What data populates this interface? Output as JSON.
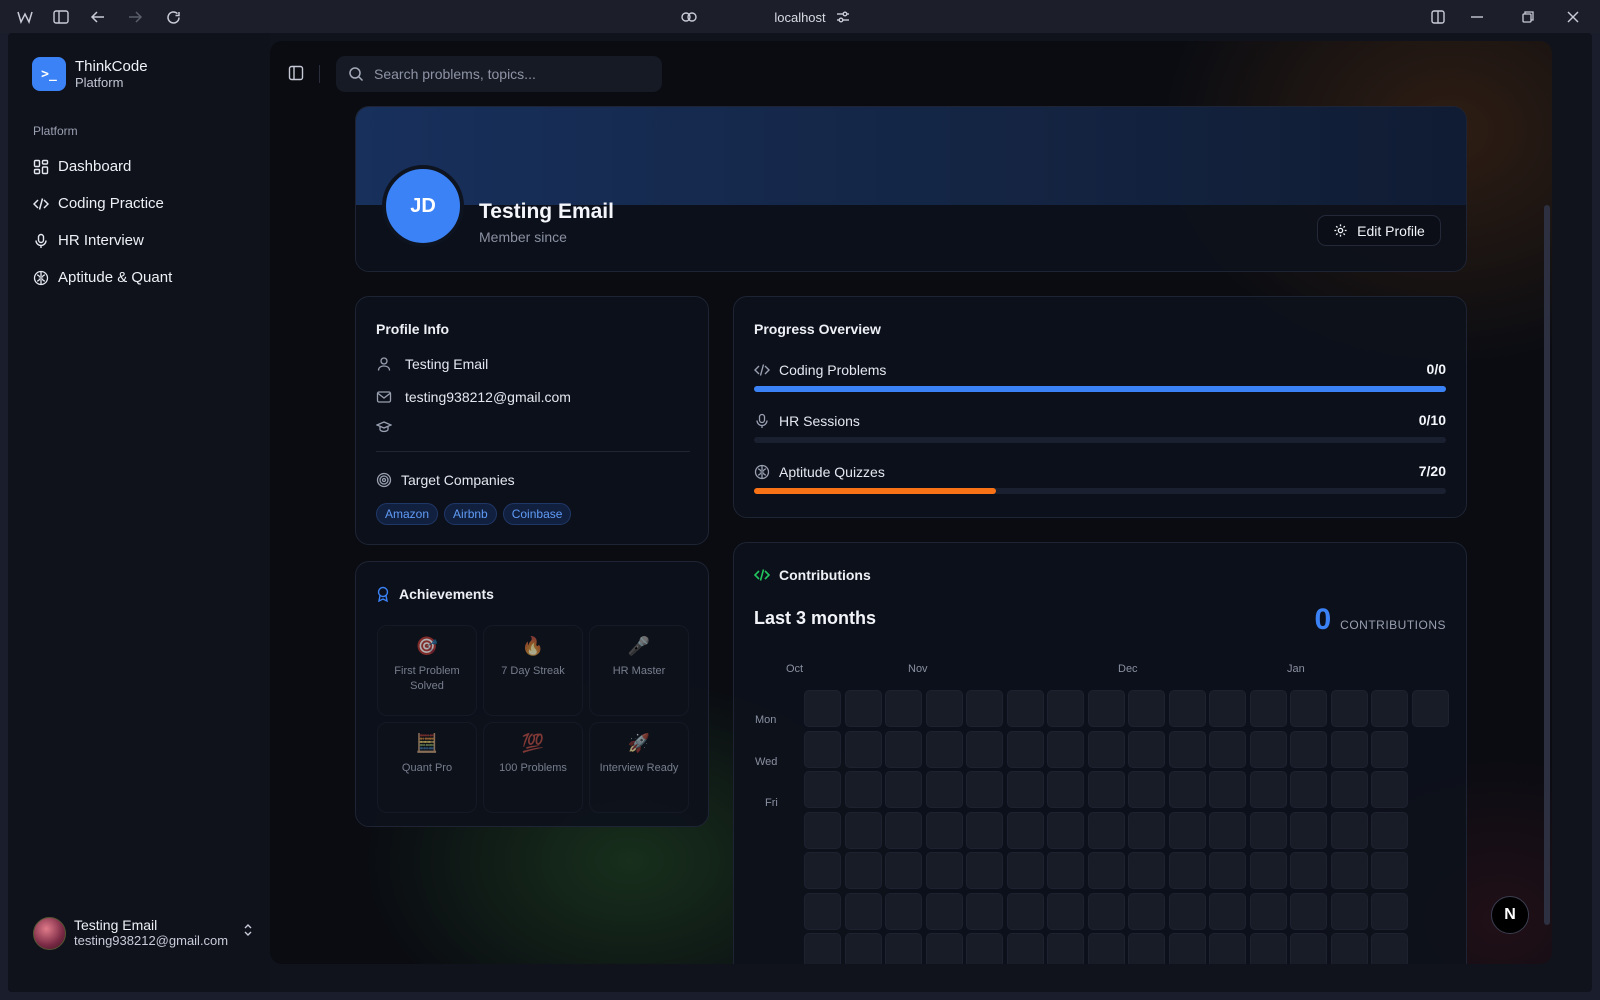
{
  "browser": {
    "url": "localhost"
  },
  "sidebar": {
    "brand_name": "ThinkCode",
    "brand_sub": "Platform",
    "section_label": "Platform",
    "items": [
      {
        "label": "Dashboard",
        "icon": "dashboard-icon"
      },
      {
        "label": "Coding Practice",
        "icon": "code-icon"
      },
      {
        "label": "HR Interview",
        "icon": "mic-icon"
      },
      {
        "label": "Aptitude & Quant",
        "icon": "brain-icon"
      }
    ],
    "user": {
      "name": "Testing Email",
      "email": "testing938212@gmail.com"
    }
  },
  "search": {
    "placeholder": "Search problems, topics..."
  },
  "profile": {
    "initials": "JD",
    "name": "Testing Email",
    "member_since": "Member since",
    "edit_label": "Edit Profile"
  },
  "profile_info": {
    "title": "Profile Info",
    "name": "Testing Email",
    "email": "testing938212@gmail.com",
    "education": "",
    "target_title": "Target Companies",
    "companies": [
      "Amazon",
      "Airbnb",
      "Coinbase"
    ]
  },
  "achievements": {
    "title": "Achievements",
    "items": [
      {
        "emoji": "🎯",
        "label": "First Problem Solved"
      },
      {
        "emoji": "🔥",
        "label": "7 Day Streak"
      },
      {
        "emoji": "🎤",
        "label": "HR Master"
      },
      {
        "emoji": "🧮",
        "label": "Quant Pro"
      },
      {
        "emoji": "💯",
        "label": "100 Problems"
      },
      {
        "emoji": "🚀",
        "label": "Interview Ready"
      }
    ]
  },
  "progress": {
    "title": "Progress Overview",
    "rows": [
      {
        "label": "Coding Problems",
        "value": "0/0",
        "fraction": 1.0,
        "color": "#3b82f6",
        "icon": "code-icon"
      },
      {
        "label": "HR Sessions",
        "value": "0/10",
        "fraction": 0.0,
        "color": "#3b82f6",
        "icon": "mic-icon"
      },
      {
        "label": "Aptitude Quizzes",
        "value": "7/20",
        "fraction": 0.35,
        "color": "#f97316",
        "icon": "brain-icon"
      }
    ]
  },
  "contributions": {
    "title": "Contributions",
    "range": "Last 3 months",
    "count": "0",
    "count_label": "CONTRIBUTIONS",
    "months": [
      "Oct",
      "Nov",
      "Dec",
      "Jan"
    ],
    "days": [
      "Mon",
      "Wed",
      "Fri"
    ]
  },
  "colors": {
    "accent": "#3b82f6",
    "orange": "#f97316",
    "background": "#0a0c12"
  }
}
